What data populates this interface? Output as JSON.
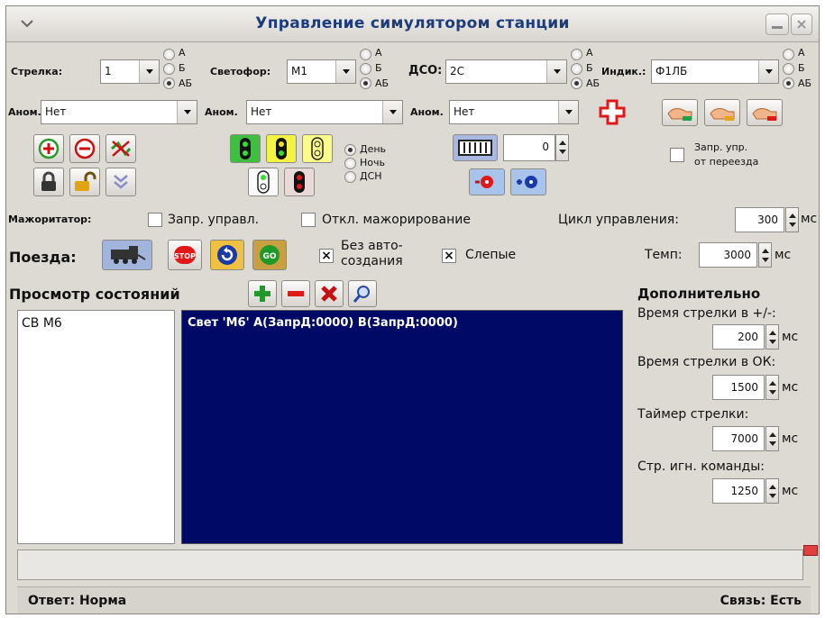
{
  "window": {
    "title": "Управление симулятором станции"
  },
  "row1": {
    "strelka": {
      "label": "Стрелка:",
      "value": "1"
    },
    "svetofor": {
      "label": "Светофор:",
      "value": "M1"
    },
    "dso": {
      "label": "ДСО:",
      "value": "2С"
    },
    "indik": {
      "label": "Индик.:",
      "value": "Ф1ЛБ"
    },
    "radio_options": [
      "А",
      "Б",
      "АБ"
    ]
  },
  "row2": {
    "anom_label": "Аном.",
    "anom_values": [
      "Нет",
      "Нет",
      "Нет"
    ]
  },
  "time_options": [
    "День",
    "Ночь",
    "ДСН"
  ],
  "counter_value": "0",
  "crossing": {
    "line1": "Запр. упр.",
    "line2": "от переезда"
  },
  "majority": {
    "label": "Мажоритатор:",
    "option1": "Запр. управл.",
    "option2": "Откл. мажорирование",
    "cycle_label": "Цикл управления:",
    "cycle_value": "300",
    "unit": "мс"
  },
  "trains": {
    "label": "Поезда:",
    "auto_line1": "Без авто-",
    "auto_line2": "создания",
    "blind_label": "Слепые",
    "tempo_label": "Темп:",
    "tempo_value": "3000",
    "unit": "мс"
  },
  "states": {
    "label": "Просмотр состояний",
    "list_items": [
      "СВ М6"
    ]
  },
  "log": {
    "line": "Свет 'М6' А(ЗапрД:0000) В(ЗапрД:0000)"
  },
  "extra": {
    "title": "Дополнительно",
    "unit": "мс",
    "fields": [
      {
        "label": "Время стрелки в +/-:",
        "value": "200"
      },
      {
        "label": "Время стрелки в ОК:",
        "value": "1500"
      },
      {
        "label": "Таймер стрелки:",
        "value": "7000"
      },
      {
        "label": "Стр. игн. команды:",
        "value": "1250"
      }
    ]
  },
  "status": {
    "answer": "Ответ: Норма",
    "connection": "Связь: Есть"
  },
  "colors": {
    "log_bg": "#000a66",
    "title": "#1c3c7c",
    "window_bg": "#ddd9d3"
  }
}
